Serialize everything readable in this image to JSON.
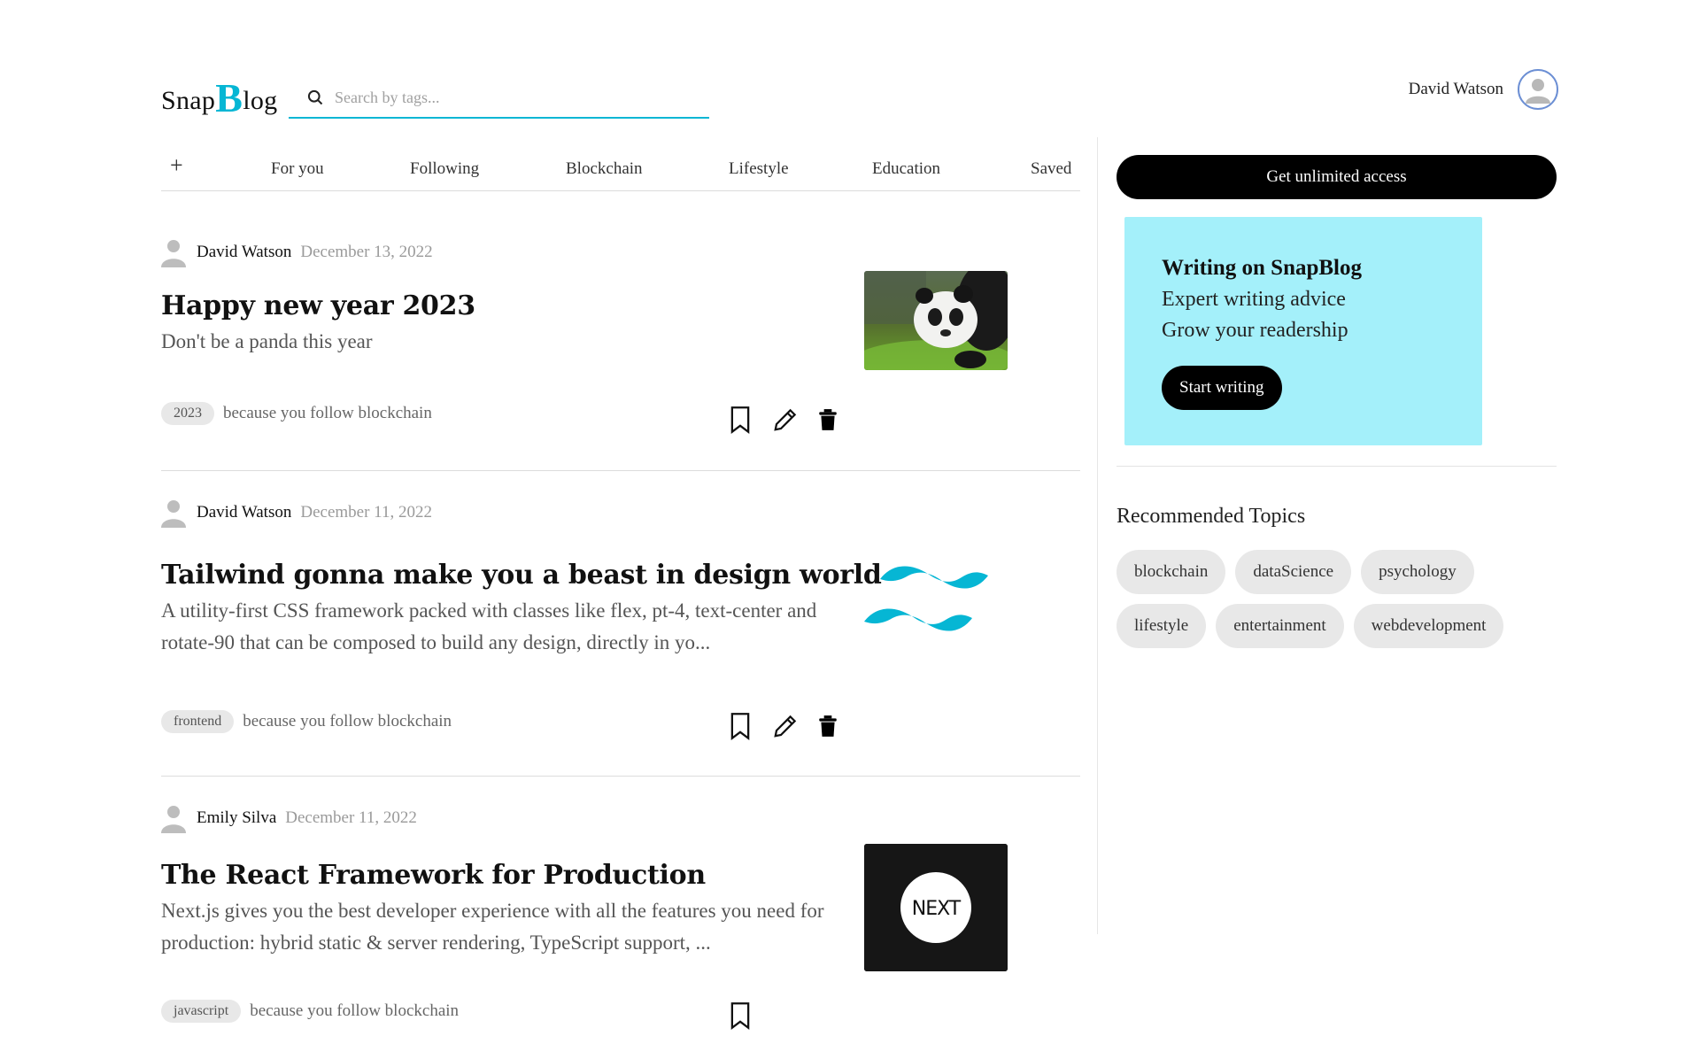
{
  "header": {
    "logo_snap": "Snap",
    "logo_b": "B",
    "logo_log": "log",
    "search_placeholder": "Search by tags...",
    "user_name": "David Watson"
  },
  "tabs": [
    "For you",
    "Following",
    "Blockchain",
    "Lifestyle",
    "Education",
    "Saved"
  ],
  "posts": [
    {
      "author": "David Watson",
      "date": "December 13, 2022",
      "title": "Happy new year 2023",
      "subtitle": "Don't be a panda this year",
      "tag": "2023",
      "reason": "because you follow blockchain",
      "thumbnail": "panda-photo"
    },
    {
      "author": "David Watson",
      "date": "December 11, 2022",
      "title": "Tailwind gonna make you a beast in design world",
      "subtitle": "A utility-first CSS framework packed with classes like flex, pt-4, text-center and rotate-90 that can be composed to build any design, directly in yo...",
      "tag": "frontend",
      "reason": "because you follow blockchain",
      "thumbnail": "tailwind-logo"
    },
    {
      "author": "Emily Silva",
      "date": "December 11, 2022",
      "title": "The React Framework for Production",
      "subtitle": "Next.js gives you the best developer experience with all the features you need for production: hybrid static & server rendering, TypeScript support, ...",
      "tag": "javascript",
      "reason": "because you follow blockchain",
      "thumbnail": "nextjs-logo",
      "thumbnail_text": "NEXT"
    }
  ],
  "sidebar": {
    "cta_label": "Get unlimited access",
    "promo": {
      "heading": "Writing on SnapBlog",
      "line1": "Expert writing advice",
      "line2": "Grow your readership",
      "button": "Start writing"
    },
    "recommended_title": "Recommended Topics",
    "topics": [
      "blockchain",
      "dataScience",
      "psychology",
      "lifestyle",
      "entertainment",
      "webdevelopment"
    ]
  },
  "colors": {
    "accent": "#06b6d4",
    "promo_bg": "#a4f0fa",
    "chip_bg": "#e8e8e8"
  }
}
